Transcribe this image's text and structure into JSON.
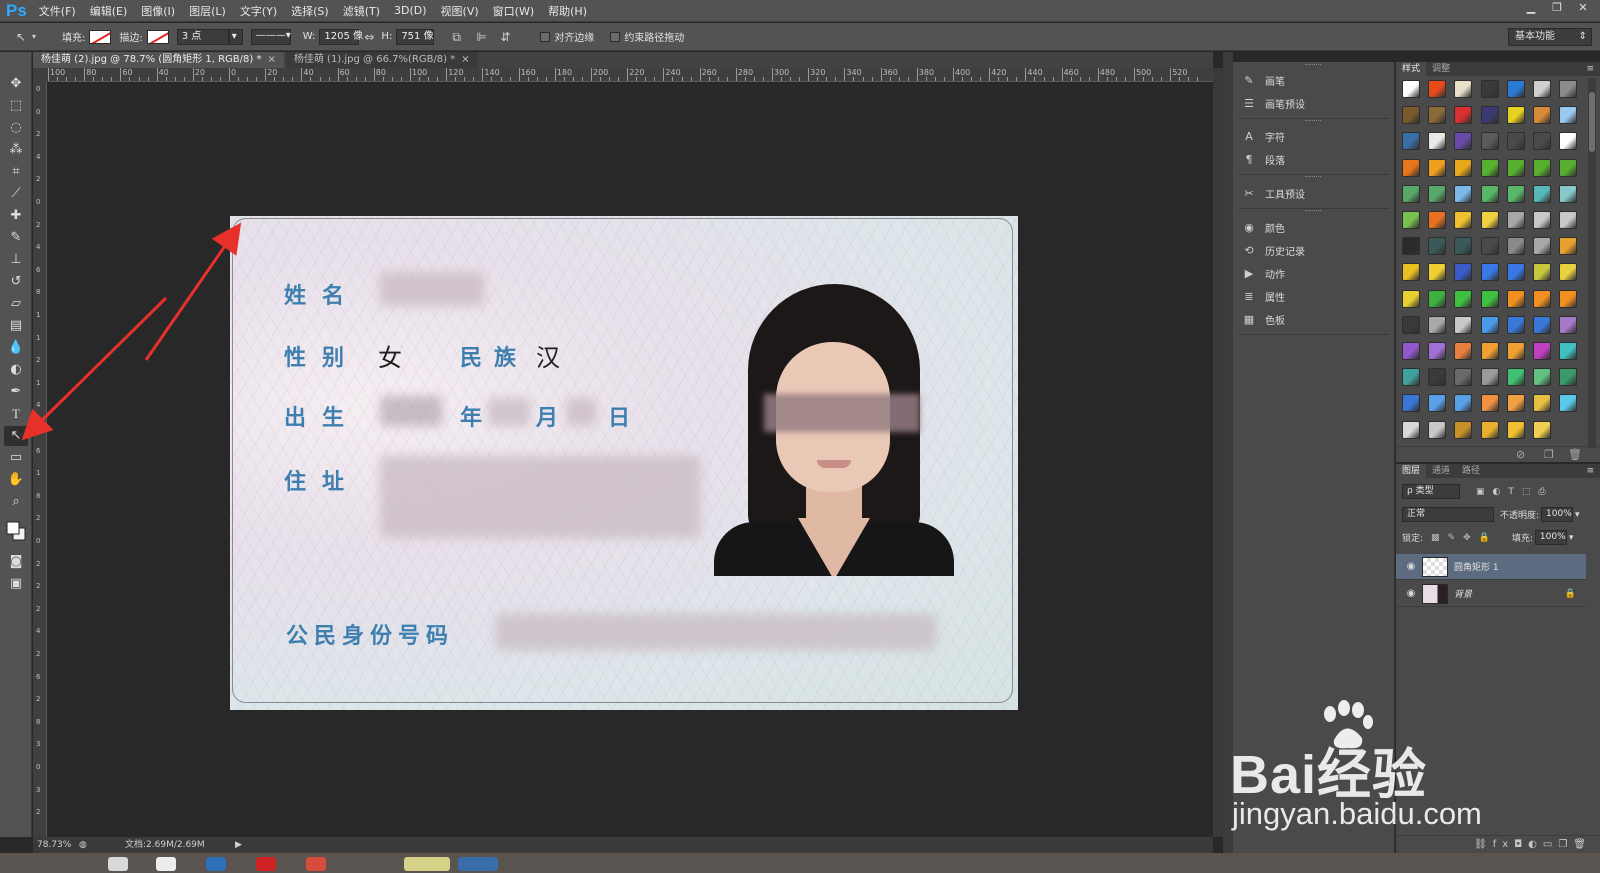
{
  "app": {
    "logo": "Ps",
    "menu": [
      "文件(F)",
      "编辑(E)",
      "图像(I)",
      "图层(L)",
      "文字(Y)",
      "选择(S)",
      "滤镜(T)",
      "3D(D)",
      "视图(V)",
      "窗口(W)",
      "帮助(H)"
    ]
  },
  "options": {
    "fill_label": "填充:",
    "stroke_label": "描边:",
    "stroke_width": "3 点",
    "w_label": "W:",
    "w_value": "1205 像",
    "h_label": "H:",
    "h_value": "751 像",
    "align_edges": "对齐边缘",
    "constrain_path": "约束路径拖动",
    "workspace": "基本功能"
  },
  "tabs": [
    {
      "label": "杨佳萌 (2).jpg @ 78.7% (圆角矩形 1, RGB/8) *",
      "active": true
    },
    {
      "label": "杨佳萌 (1).jpg @ 66.7%(RGB/8) *",
      "active": false
    }
  ],
  "ruler": {
    "h": [
      "100",
      "80",
      "60",
      "40",
      "20",
      "0",
      "20",
      "40",
      "60",
      "80",
      "100",
      "120",
      "140",
      "160",
      "180",
      "200",
      "220",
      "240",
      "260",
      "280",
      "300",
      "320",
      "340",
      "360",
      "380",
      "400",
      "420",
      "440",
      "460",
      "480",
      "500",
      "520"
    ],
    "v": [
      "0",
      "0",
      "2",
      "4",
      "2",
      "0",
      "2",
      "4",
      "6",
      "8",
      "1",
      "1",
      "2",
      "1",
      "4",
      "1",
      "6",
      "1",
      "8",
      "2",
      "0",
      "2",
      "2",
      "2",
      "4",
      "2",
      "6",
      "2",
      "8",
      "3",
      "0",
      "3",
      "2"
    ]
  },
  "card": {
    "name_label": "姓名",
    "gender_label": "性别",
    "gender_value": "女",
    "ethnic_label": "民族",
    "ethnic_value": "汉",
    "birth_label": "出生",
    "year_label": "年",
    "month_label": "月",
    "day_label": "日",
    "address_label": "住址",
    "id_label": "公民身份号码"
  },
  "status": {
    "zoom": "78.73%",
    "doc": "文档:2.69M/2.69M"
  },
  "mid_panel": {
    "items": [
      {
        "icon": "brush-icon",
        "label": "画笔"
      },
      {
        "icon": "brush-preset-icon",
        "label": "画笔预设"
      },
      {
        "icon": "character-icon",
        "label": "字符"
      },
      {
        "icon": "paragraph-icon",
        "label": "段落"
      },
      {
        "icon": "tool-preset-icon",
        "label": "工具预设"
      },
      {
        "icon": "color-icon",
        "label": "颜色"
      },
      {
        "icon": "history-icon",
        "label": "历史记录"
      },
      {
        "icon": "actions-icon",
        "label": "动作"
      },
      {
        "icon": "properties-icon",
        "label": "属性"
      },
      {
        "icon": "swatches-icon",
        "label": "色板"
      }
    ]
  },
  "styles_panel": {
    "tabs": [
      "样式",
      "调整"
    ]
  },
  "layers_panel": {
    "tabs": [
      "图层",
      "通道",
      "路径"
    ],
    "kind_filter": "ρ 类型",
    "blend_mode": "正常",
    "opacity_label": "不透明度:",
    "opacity_value": "100%",
    "lock_label": "锁定:",
    "fill_label": "填充:",
    "fill_value": "100%",
    "layers": [
      {
        "name": "圆角矩形 1",
        "selected": true
      },
      {
        "name": "背景",
        "selected": false
      }
    ]
  },
  "watermark": {
    "brand": "Bai经验",
    "url": "jingyan.baidu.com"
  },
  "colors": {
    "accent": "#31a8ff",
    "arrow": "#e8302a",
    "selected_layer": "#5d6b80"
  }
}
